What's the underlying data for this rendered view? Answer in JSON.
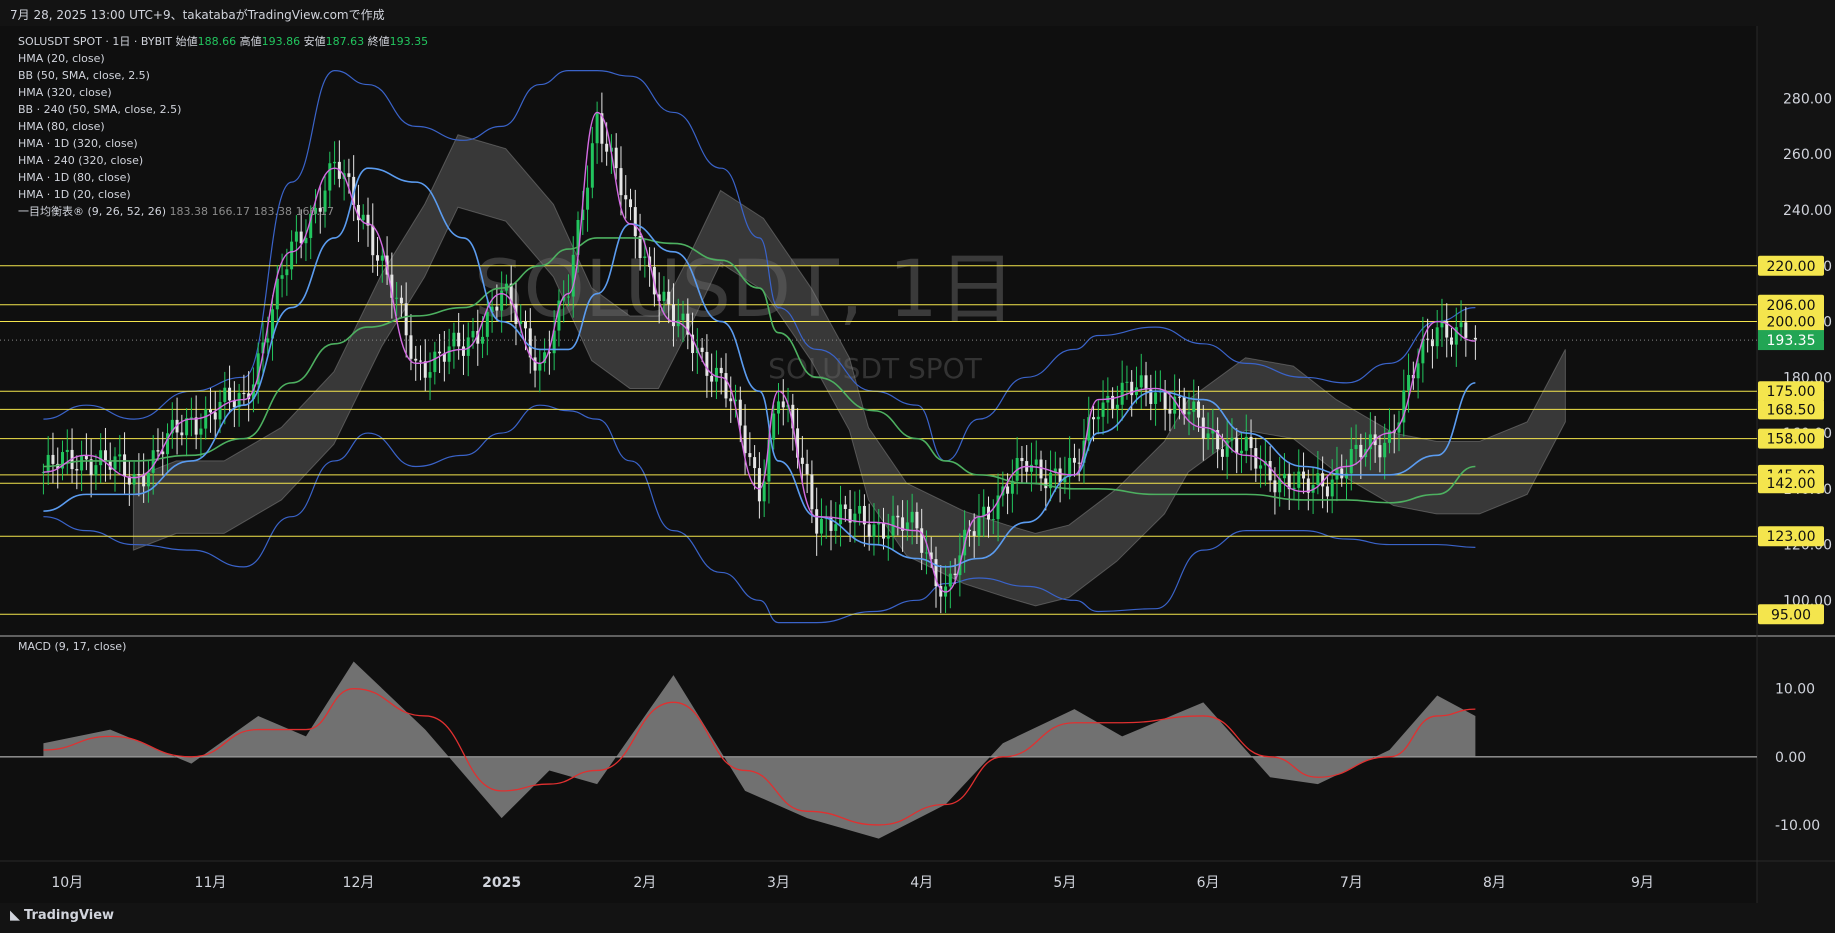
{
  "header": {
    "text": "7月 28, 2025 13:00 UTC+9、takatabaがTradingView.comで作成"
  },
  "legend": {
    "symbol": "SOLUSDT SPOT · 1日 · BYBIT",
    "open_label": "始値",
    "open": "188.66",
    "high_label": "高値",
    "high": "193.86",
    "low_label": "安値",
    "low": "187.63",
    "close_label": "終値",
    "close": "193.35",
    "indicators": [
      "HMA (20, close)",
      "BB (50, SMA, close, 2.5)",
      "HMA (320, close)",
      "BB · 240 (50, SMA, close, 2.5)",
      "HMA (80, close)",
      "HMA · 1D (320, close)",
      "HMA · 240 (320, close)",
      "HMA · 1D (80, close)",
      "HMA · 1D (20, close)"
    ],
    "ichimoku": {
      "label": "一目均衡表® (9, 26, 52, 26)",
      "v1": "183.38",
      "v2": "166.17",
      "v3": "183.38",
      "v4": "166.17"
    }
  },
  "watermark": {
    "symbol": "SOLUSDT, 1日",
    "subtitle": "SOLUSDT SPOT"
  },
  "macd_label": "MACD (9, 17, close)",
  "footer": {
    "brand": "TradingView",
    "logo_icon": "tradingview-logo-icon"
  },
  "colors": {
    "bg": "#0f0f0f",
    "up": "#22c55e",
    "down": "#e5e5e5",
    "level": "#f4e54d",
    "hma20": "#d46be3",
    "hma80": "#5b9cf0",
    "hma320": "#4db060",
    "bb": "#3a63c9",
    "cloud": "#6b6b6b",
    "macd_hist": "#8a8a8a",
    "signal": "#e03030",
    "price_tag": "#22a554"
  },
  "chart_data": [
    {
      "type": "line",
      "title": "SOLUSDT SPOT · 1日 · BYBIT",
      "price_axis": {
        "ticks": [
          100,
          120,
          140,
          160,
          180,
          200,
          220,
          240,
          260,
          280
        ],
        "ylim": [
          89,
          306
        ]
      },
      "time_axis": {
        "labels": [
          "10月",
          "11月",
          "12月",
          "2025",
          "2月",
          "3月",
          "4月",
          "5月",
          "6月",
          "7月",
          "8月",
          "9月"
        ]
      },
      "horizontal_levels": [
        220,
        206,
        200,
        175,
        168.5,
        158,
        145,
        142,
        123,
        95
      ],
      "level_labels": [
        "220.00",
        "206.00",
        "200.00",
        "175.00",
        "168.50",
        "158.00",
        "145.00",
        "142.00",
        "123.00",
        "95.00"
      ],
      "last_price": {
        "value": 193.35,
        "label": "193.35"
      },
      "price_series": {
        "name": "SOLUSDT",
        "x": [
          "2024-10-01",
          "2024-10-10",
          "2024-10-20",
          "2024-11-01",
          "2024-11-12",
          "2024-11-22",
          "2024-12-01",
          "2024-12-08",
          "2024-12-18",
          "2024-12-28",
          "2025-01-05",
          "2025-01-13",
          "2025-01-19",
          "2025-01-25",
          "2025-02-01",
          "2025-02-10",
          "2025-02-20",
          "2025-02-28",
          "2025-03-04",
          "2025-03-12",
          "2025-03-24",
          "2025-04-02",
          "2025-04-08",
          "2025-04-15",
          "2025-04-25",
          "2025-05-05",
          "2025-05-10",
          "2025-05-22",
          "2025-06-01",
          "2025-06-10",
          "2025-06-22",
          "2025-07-01",
          "2025-07-10",
          "2025-07-20",
          "2025-07-28"
        ],
        "y": [
          146,
          152,
          144,
          165,
          172,
          225,
          255,
          235,
          185,
          190,
          210,
          185,
          210,
          275,
          235,
          200,
          180,
          140,
          175,
          130,
          128,
          125,
          103,
          130,
          148,
          145,
          172,
          176,
          162,
          152,
          139,
          148,
          160,
          200,
          193
        ]
      },
      "bollinger": {
        "name": "BB (50, SMA, close, 2.5)",
        "upper": [
          165,
          170,
          165,
          175,
          180,
          250,
          290,
          285,
          270,
          265,
          270,
          285,
          290,
          290,
          288,
          275,
          255,
          230,
          205,
          190,
          175,
          170,
          150,
          165,
          180,
          190,
          195,
          198,
          192,
          185,
          180,
          178,
          185,
          200,
          205
        ],
        "lower": [
          130,
          125,
          120,
          118,
          112,
          130,
          150,
          160,
          148,
          152,
          160,
          170,
          168,
          165,
          150,
          125,
          110,
          100,
          92,
          92,
          96,
          100,
          106,
          108,
          105,
          100,
          96,
          97,
          118,
          125,
          125,
          122,
          120,
          120,
          119
        ]
      },
      "hma80": [
        132,
        138,
        138,
        150,
        170,
        205,
        230,
        255,
        250,
        230,
        200,
        190,
        190,
        210,
        235,
        225,
        200,
        175,
        150,
        130,
        120,
        115,
        112,
        115,
        128,
        145,
        160,
        175,
        172,
        160,
        148,
        145,
        145,
        152,
        178
      ],
      "hma320": [
        148,
        150,
        150,
        152,
        158,
        178,
        192,
        198,
        202,
        205,
        212,
        220,
        226,
        230,
        230,
        228,
        222,
        212,
        196,
        180,
        168,
        158,
        150,
        145,
        142,
        140,
        140,
        138,
        138,
        138,
        136,
        136,
        135,
        138,
        148
      ]
    },
    {
      "type": "area",
      "title": "MACD (9, 17, close)",
      "yaxis": {
        "ticks": [
          10,
          0,
          -10
        ],
        "ylim": [
          -15,
          17
        ]
      },
      "x": [
        "2024-10-01",
        "2024-10-15",
        "2024-11-01",
        "2024-11-15",
        "2024-11-25",
        "2024-12-05",
        "2024-12-20",
        "2025-01-05",
        "2025-01-15",
        "2025-01-25",
        "2025-02-10",
        "2025-02-25",
        "2025-03-10",
        "2025-03-25",
        "2025-04-08",
        "2025-04-20",
        "2025-05-05",
        "2025-05-15",
        "2025-06-01",
        "2025-06-15",
        "2025-06-25",
        "2025-07-10",
        "2025-07-20",
        "2025-07-28"
      ],
      "series": [
        {
          "name": "MACD",
          "values": [
            2,
            4,
            -1,
            6,
            3,
            14,
            4,
            -9,
            -2,
            -4,
            12,
            -5,
            -9,
            -12,
            -7,
            2,
            7,
            3,
            8,
            -3,
            -4,
            1,
            9,
            6
          ]
        },
        {
          "name": "Signal",
          "values": [
            1,
            3,
            0,
            4,
            4,
            10,
            6,
            -5,
            -4,
            -2,
            8,
            -2,
            -8,
            -10,
            -7,
            0,
            5,
            5,
            6,
            0,
            -3,
            0,
            6,
            7
          ]
        }
      ]
    }
  ]
}
